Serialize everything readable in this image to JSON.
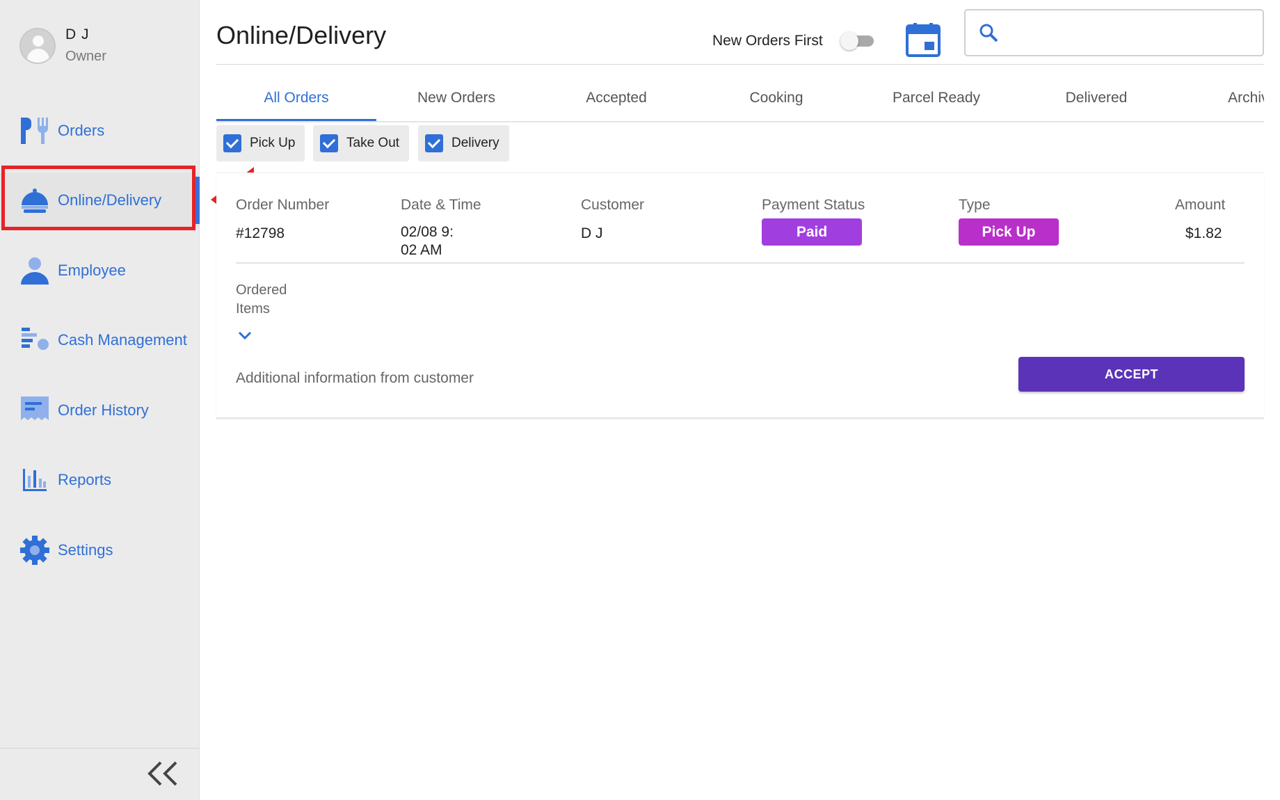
{
  "profile": {
    "name": "D J",
    "role": "Owner"
  },
  "sidebar": {
    "items": [
      {
        "label": "Orders",
        "icon": "fork-utensils-icon"
      },
      {
        "label": "Online/Delivery",
        "icon": "cloche-icon",
        "active": true
      },
      {
        "label": "Employee",
        "icon": "person-icon"
      },
      {
        "label": "Cash Management",
        "icon": "cash-management-icon"
      },
      {
        "label": "Order History",
        "icon": "receipt-icon"
      },
      {
        "label": "Reports",
        "icon": "bar-chart-icon"
      },
      {
        "label": "Settings",
        "icon": "gear-icon"
      }
    ],
    "collapse_icon": "double-chevron-left-icon"
  },
  "header": {
    "title": "Online/Delivery",
    "new_orders_first_label": "New Orders First",
    "new_orders_first_on": false,
    "search_placeholder": ""
  },
  "tabs": [
    {
      "label": "All Orders",
      "active": true
    },
    {
      "label": "New Orders"
    },
    {
      "label": "Accepted"
    },
    {
      "label": "Cooking"
    },
    {
      "label": "Parcel Ready"
    },
    {
      "label": "Delivered"
    },
    {
      "label": "Archived"
    }
  ],
  "filters": [
    {
      "label": "Pick Up",
      "checked": true
    },
    {
      "label": "Take Out",
      "checked": true
    },
    {
      "label": "Delivery",
      "checked": true
    }
  ],
  "order": {
    "headers": {
      "number": "Order Number",
      "datetime": "Date & Time",
      "customer": "Customer",
      "payment_status": "Payment Status",
      "type": "Type",
      "amount": "Amount"
    },
    "number": "#12798",
    "datetime_line1": "02/08 9:",
    "datetime_line2": "02 AM",
    "customer": "D J",
    "payment_status": "Paid",
    "type": "Pick Up",
    "amount": "$1.82",
    "ordered_items_label": "Ordered Items",
    "additional_info_label": "Additional information from customer",
    "accept_label": "ACCEPT"
  },
  "colors": {
    "accent": "#2f6fd6",
    "paid_badge": "#a13ee0",
    "pickup_badge": "#b92fc9",
    "accept_button": "#5b33b8",
    "highlight": "#e52328"
  }
}
